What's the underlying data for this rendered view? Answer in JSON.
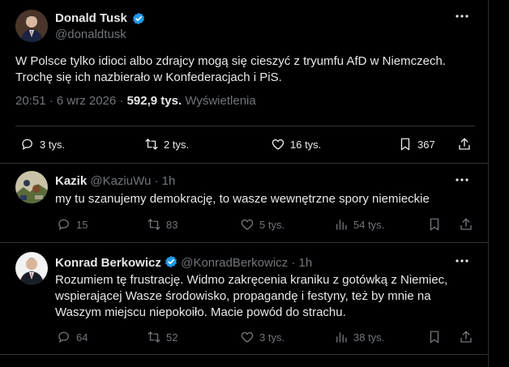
{
  "main_post": {
    "author_name": "Donald Tusk",
    "handle": "@donaldtusk",
    "text_line1": "W Polsce tylko idioci albo zdrajcy mogą się cieszyć z tryumfu AfD w Niemczech.",
    "text_line2": "Trochę się ich  nazbierało  w Konfederacjach i PiS.",
    "timestamp": "20:51 · 6 wrz 2026 ·",
    "views_count": "592,9 tys.",
    "views_label": "Wyświetlenia",
    "replies": "3 tys.",
    "reposts": "2 tys.",
    "likes": "16 tys.",
    "bookmarks": "367"
  },
  "replies": [
    {
      "author_name": "Kazik",
      "handle": "@KaziuWu",
      "time": "· 1h",
      "text": "my tu szanujemy demokrację, to wasze wewnętrzne spory niemieckie",
      "replies": "15",
      "reposts": "83",
      "likes": "5 tys.",
      "views": "54 tys."
    },
    {
      "author_name": "Konrad Berkowicz",
      "handle": "@KonradBerkowicz",
      "time": "· 1h",
      "text_lines": [
        "Rozumiem tę frustrację. Widmo zakręcenia kraniku z gotówką z Niemiec,",
        "wspierającej Wasze środowisko, propagandę i festyny, też by mnie na",
        "Waszym miejscu niepokoiło. Macie powód do strachu."
      ],
      "replies": "64",
      "reposts": "52",
      "likes": "3 tys.",
      "views": "38 tys."
    }
  ],
  "colors": {
    "background": "#000000",
    "text": "#e7e9ea",
    "muted": "#71767b",
    "border": "#2f3336",
    "verified": "#1d9bf0"
  }
}
